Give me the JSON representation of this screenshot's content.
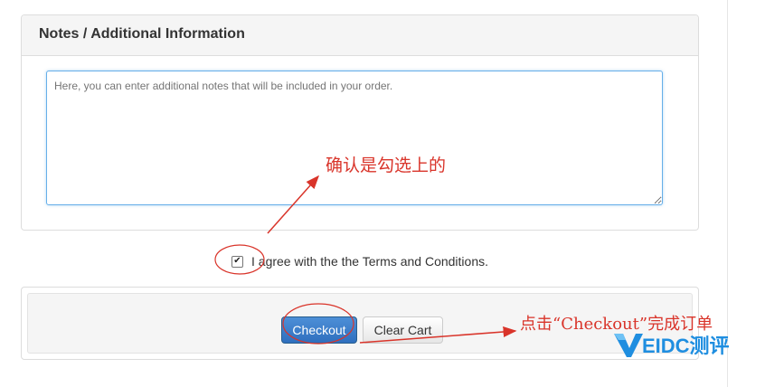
{
  "notes_panel": {
    "title": "Notes / Additional Information",
    "placeholder": "Here, you can enter additional notes that will be included in your order."
  },
  "terms": {
    "checked": true,
    "label": "I agree with the the Terms and Conditions."
  },
  "actions": {
    "checkout_label": "Checkout",
    "clear_cart_label": "Clear Cart"
  },
  "annotations": {
    "confirm_checked": "确认是勾选上的",
    "click_checkout": "点击“Checkout”完成订单",
    "color": "#d9342a"
  },
  "watermark": {
    "text": "EIDC测评",
    "color": "#1f8ee0"
  }
}
